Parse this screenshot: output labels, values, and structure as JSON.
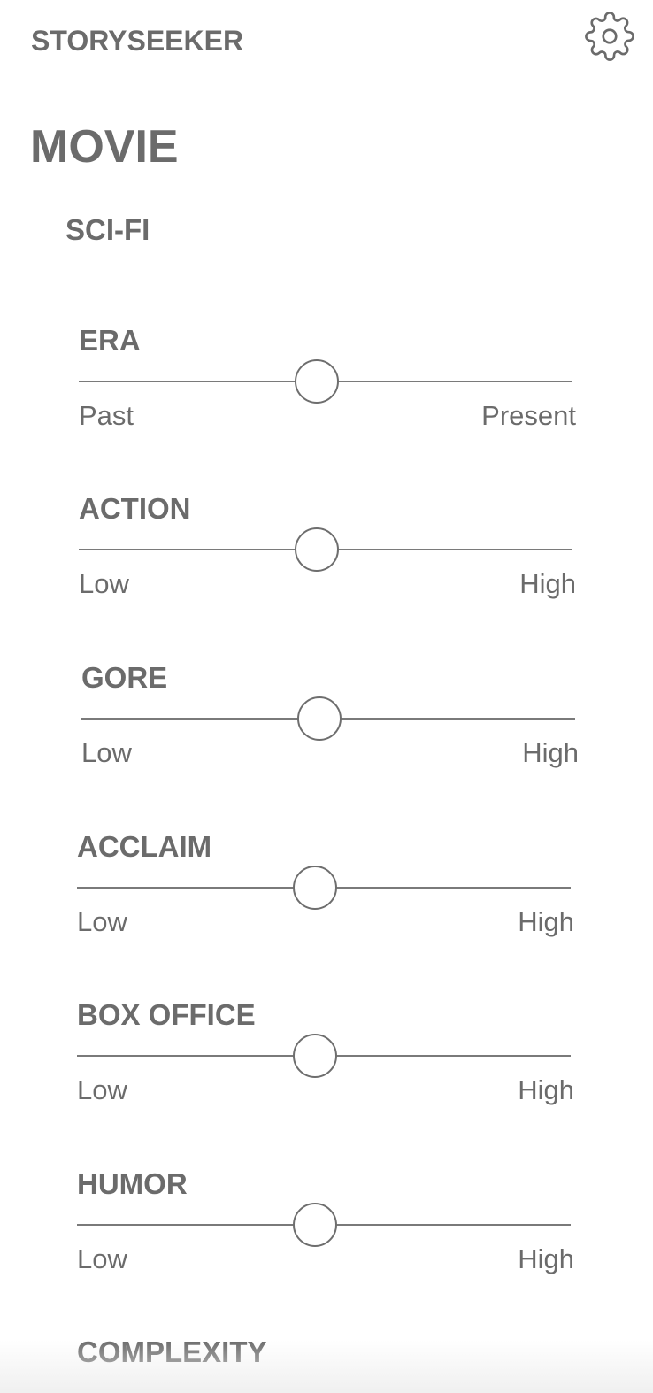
{
  "header": {
    "app_title": "STORYSEEKER",
    "settings_icon": "gear-icon"
  },
  "media_type": "MOVIE",
  "genre": "SCI-FI",
  "sliders": [
    {
      "label": "ERA",
      "min_label": "Past",
      "max_label": "Present",
      "value": 0.48
    },
    {
      "label": "ACTION",
      "min_label": "Low",
      "max_label": "High",
      "value": 0.48
    },
    {
      "label": "GORE",
      "min_label": "Low",
      "max_label": "High",
      "value": 0.48
    },
    {
      "label": "ACCLAIM",
      "min_label": "Low",
      "max_label": "High",
      "value": 0.48
    },
    {
      "label": "BOX OFFICE",
      "min_label": "Low",
      "max_label": "High",
      "value": 0.48
    },
    {
      "label": "HUMOR",
      "min_label": "Low",
      "max_label": "High",
      "value": 0.48
    },
    {
      "label": "COMPLEXITY"
    }
  ],
  "colors": {
    "text": "#6b6b6b",
    "track": "#7a7a7a",
    "background": "#ffffff"
  }
}
